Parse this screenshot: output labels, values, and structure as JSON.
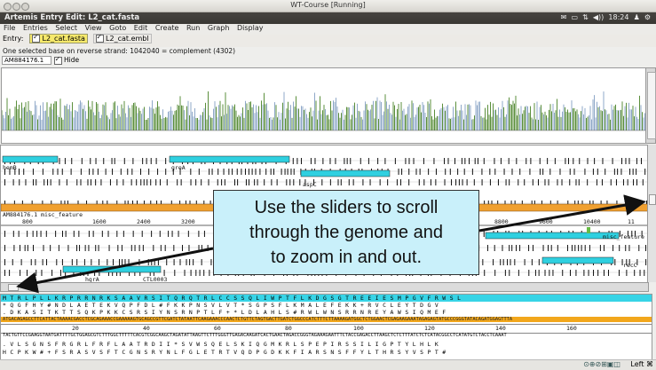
{
  "window": {
    "title": "WT-Course [Running]"
  },
  "panel": {
    "title": "Artemis Entry Edit: L2_cat.fasta",
    "clock": "18:24",
    "tray_icons": [
      "mail-icon",
      "battery-icon",
      "network-icon",
      "volume-icon",
      "user-icon",
      "settings-icon"
    ]
  },
  "menu": [
    "File",
    "Entries",
    "Select",
    "View",
    "Goto",
    "Edit",
    "Create",
    "Run",
    "Graph",
    "Display"
  ],
  "entry": {
    "label": "Entry:",
    "e1": "L2_cat.fasta",
    "e2": "L2_cat.embl"
  },
  "status": "One selected base on reverse strand: 1042040  = complement (4302)",
  "sequence_selector": {
    "value": "AM884176.1",
    "hide_label": "Hide"
  },
  "features": {
    "hemB": "hemB",
    "greA": "greA",
    "aspC": "aspC",
    "recC": "recC",
    "hgrA": "hgrA",
    "ctl": "CTL0003",
    "misc1": "AM884176.1  misc_feature",
    "misc2": "misc_feature"
  },
  "ruler": [
    "800",
    "1600",
    "2400",
    "3200",
    "8800",
    "9600",
    "10400",
    "11"
  ],
  "base_ruler": [
    "20",
    "40",
    "60",
    "80",
    "100",
    "120",
    "140",
    "160"
  ],
  "sequences": {
    "f1": "M T R L P L L K R P R R N R K S A A V R S I T Q R Q T R L C C S S Q L I W P T F L K D G S G T R E E I E S M P G V F R W S L",
    "f2": "* Q G F H Y # N D L A E T E K V Q P F D L # F K K P N S V L V T * S G P S F L K M A L E F E K K + R V C L E Y T D G V",
    "f3": ". D K A S I T K T T S Q K P K K C S R S I Y N S R N P T L F + * L D L A H L S # R W L W N S R R N R E Y A W S I Q M E F",
    "fwd": "ATGACAGAGCCTTCATTACTAAAACGACCTCGCAGAAACCGAAAAAGTGCAGCCGTTCGATCTATAATTCAAGAAACCCAACTCTGTTCTAGTGACTTGATCTGGCCCATCTTTCTTAAAAGATGGCTCTGGAACTCGAGAAGAAATAGAGAGTATGCCCGGGTATACAGATGGAGTTTA",
    "rev": "TACTGTTCCGAAGGTAATGATTTTGCTGGAGCGTCTTTGGCTTTTTCACGTCGGCAAGCTAGATATTAAGTTCTTTGGGTTGAGACAAGATCACTGAACTAGACCGGGTAGAAAGAATTTCTACCGAGACCTTAAGCTCTCTTTATCTCTCATACGGCCTCATATGTCTACCTCAAAT",
    "r1": ". V L S G N S F R G R L F R F L A A T R D I I * S V W S Q E L S K I Q G M K R L S P E P I R S S I L I G P T Y L H L K",
    "r2": "H C P K W # + F S R A S V S F T C G N S R Y N L F G L E T R T V Q D P G D K K F I A R S N S F F Y L T H R S Y V S P T #"
  },
  "callout": {
    "line1": "Use the sliders to scroll",
    "line2": "through the genome and",
    "line3": "to zoom in and out."
  },
  "dock": {
    "label": "Left ⌘"
  },
  "colors": {
    "gene": "#2fd0e0",
    "misc": "#f0a030",
    "frame_header": "#37d4e6",
    "selected": "#f2a71c"
  }
}
